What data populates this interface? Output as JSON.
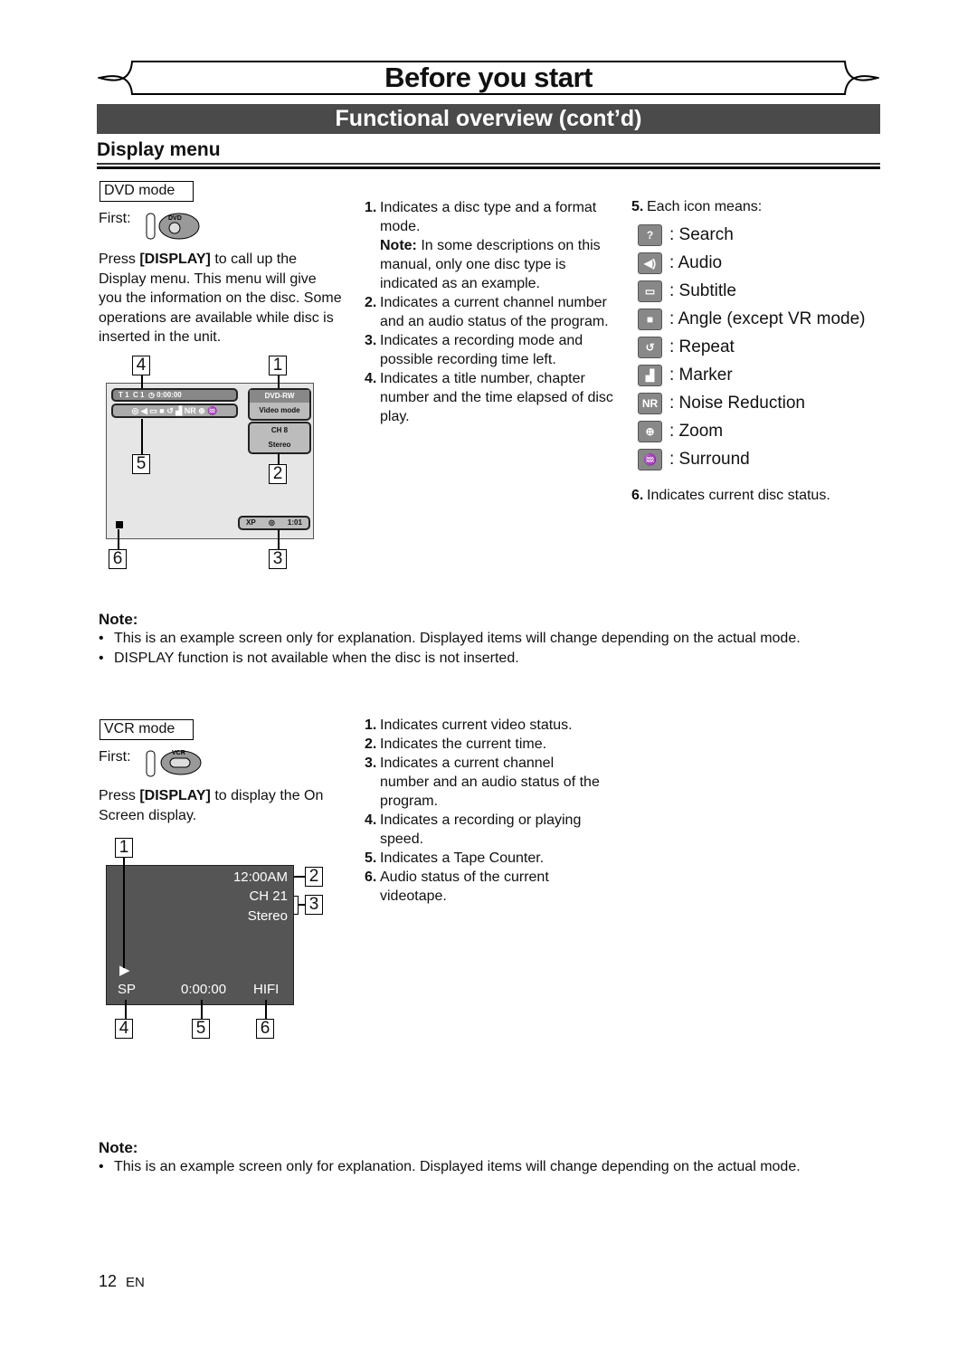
{
  "header": {
    "section": "Before you start",
    "subtitle": "Functional overview (cont’d)",
    "heading": "Display menu"
  },
  "dvd": {
    "mode_label": "DVD mode",
    "first_label": "First:",
    "first_icon": "dvd-disc-icon",
    "intro": [
      "Press ",
      "[DISPLAY]",
      " to call up the Display menu. This menu will give you the information on the disc. Some operations are available while disc is inserted in the unit."
    ],
    "screen": {
      "title_label": "T",
      "title_no": "1",
      "chapter_label": "C",
      "chapter_no": "1",
      "time": "0:00:00",
      "disc": "DVD-RW",
      "format": "Video mode",
      "channel": "CH 8",
      "audio": "Stereo",
      "rec_mode": "XP",
      "remaining": "1:01"
    },
    "callouts": [
      "1",
      "2",
      "3",
      "4",
      "5",
      "6"
    ],
    "items": [
      {
        "n": "1.",
        "text": "Indicates a disc type and a format mode.",
        "note_label": "Note:",
        "note": " In some descriptions on this manual, only one disc type is indicated as an example."
      },
      {
        "n": "2.",
        "text": "Indicates a current channel number and an audio status of the program."
      },
      {
        "n": "3.",
        "text": "Indicates a recording mode and possible recording time left."
      },
      {
        "n": "4.",
        "text": "Indicates a title number, chapter number and the time elapsed of disc play."
      }
    ],
    "item5": {
      "n": "5.",
      "text": "Each icon means:"
    },
    "icons": [
      {
        "icon": "search-icon",
        "glyph": "?",
        "label": ": Search"
      },
      {
        "icon": "audio-icon",
        "glyph": "◀)",
        "label": ": Audio"
      },
      {
        "icon": "subtitle-icon",
        "glyph": "▭",
        "label": ": Subtitle"
      },
      {
        "icon": "angle-icon",
        "glyph": "■",
        "label": ": Angle (except VR mode)"
      },
      {
        "icon": "repeat-icon",
        "glyph": "↺",
        "label": ": Repeat"
      },
      {
        "icon": "marker-icon",
        "glyph": "▟",
        "label": ": Marker"
      },
      {
        "icon": "noise-reduction-icon",
        "glyph": "NR",
        "label": ": Noise Reduction"
      },
      {
        "icon": "zoom-icon",
        "glyph": "⊕",
        "label": ": Zoom"
      },
      {
        "icon": "surround-icon",
        "glyph": "♒",
        "label": ": Surround"
      }
    ],
    "item6": {
      "n": "6.",
      "text": "Indicates current disc status."
    },
    "note": {
      "title": "Note:",
      "bullets": [
        "This is an example screen only for explanation. Displayed items will change depending on the actual mode.",
        "DISPLAY function is not available when the disc is not inserted."
      ]
    }
  },
  "vcr": {
    "mode_label": "VCR mode",
    "first_label": "First:",
    "first_icon": "vcr-tape-icon",
    "intro": [
      "Press ",
      "[DISPLAY]",
      " to display the On Screen display."
    ],
    "screen": {
      "time": "12:00AM",
      "channel": "CH 21",
      "audio": "Stereo",
      "speed": "SP",
      "counter": "0:00:00",
      "hifi": "HIFI"
    },
    "items": [
      {
        "n": "1.",
        "text": "Indicates current video status."
      },
      {
        "n": "2.",
        "text": "Indicates the current time."
      },
      {
        "n": "3.",
        "text": "Indicates a current channel number and an audio status of the program."
      },
      {
        "n": "4.",
        "text": "Indicates a recording or playing speed."
      },
      {
        "n": "5.",
        "text": "Indicates a Tape Counter."
      },
      {
        "n": "6.",
        "text": "Audio status of the current videotape."
      }
    ],
    "note": {
      "title": "Note:",
      "bullets": [
        "This is an example screen only for explanation. Displayed items will change depending on the actual mode."
      ]
    }
  },
  "footer": {
    "page": "12",
    "lang": "EN"
  }
}
